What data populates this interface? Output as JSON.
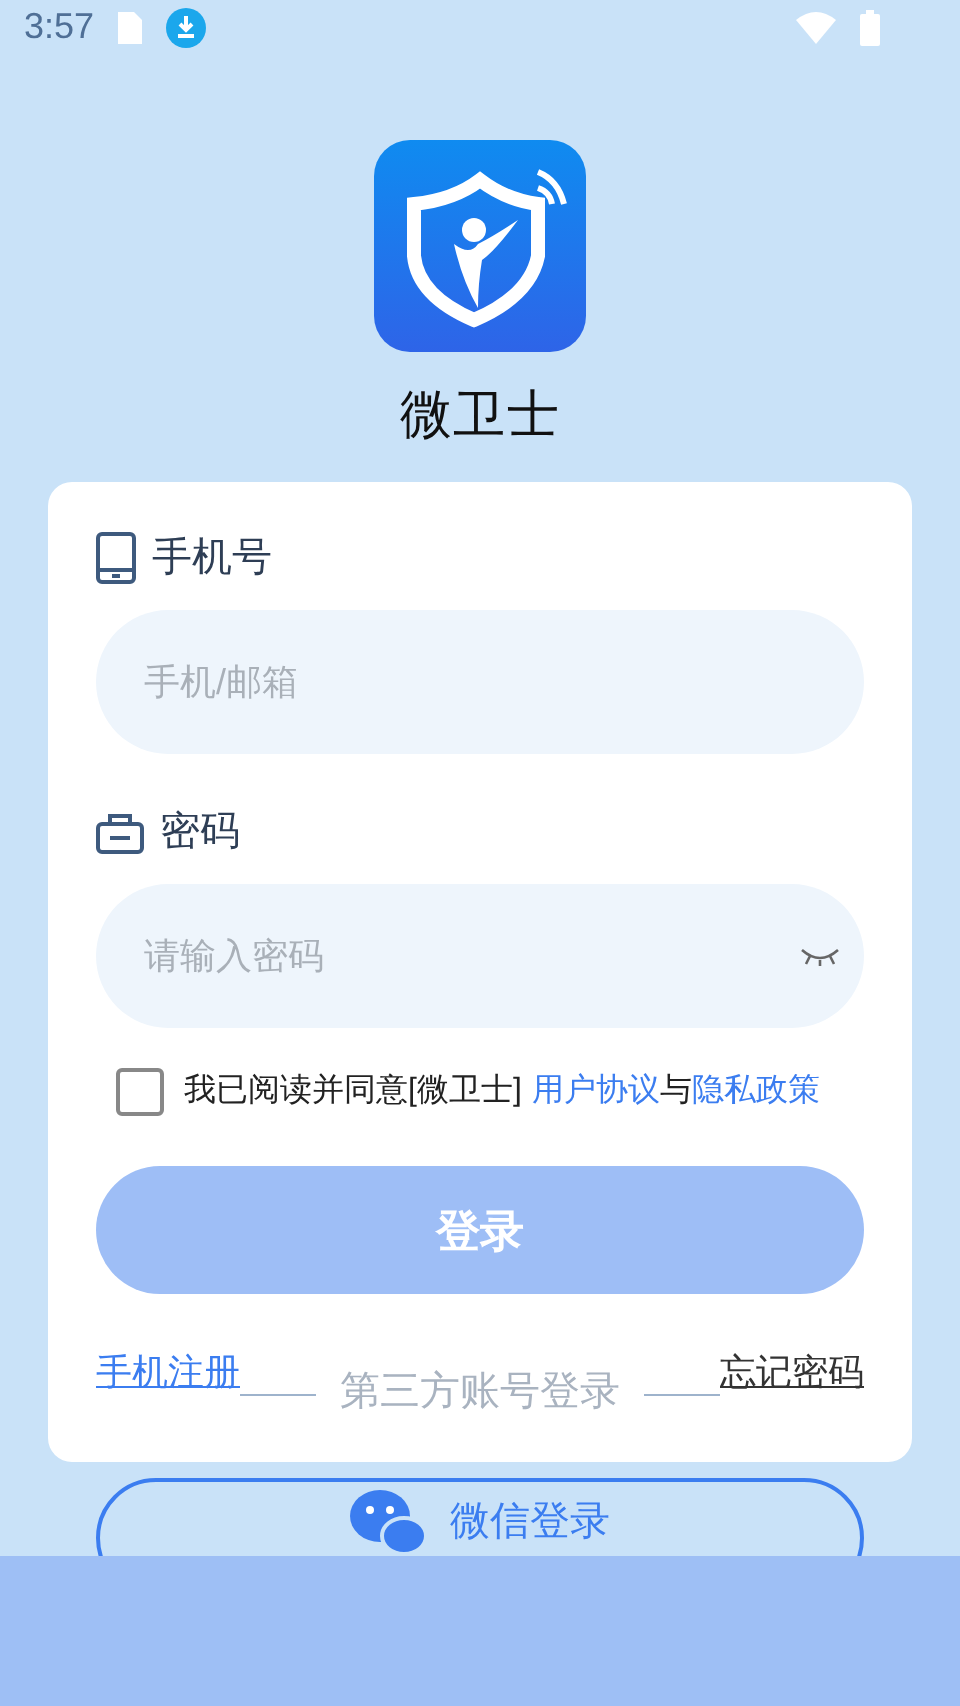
{
  "status_bar": {
    "time": "3:57"
  },
  "app": {
    "name": "微卫士"
  },
  "phone": {
    "label": "手机号",
    "placeholder": "手机/邮箱"
  },
  "password": {
    "label": "密码",
    "placeholder": "请输入密码"
  },
  "agreement": {
    "checked": false,
    "text": "我已阅读并同意[微卫士]",
    "link_1": "用户协议",
    "joiner": "与",
    "link_2": "隐私政策"
  },
  "login_button": {
    "label": "登录",
    "disabled": true
  },
  "links": {
    "register": "手机注册",
    "third_party": "第三方账号登录",
    "forgot": "忘记密码"
  },
  "wechat_button": {
    "label": "微信登录"
  }
}
